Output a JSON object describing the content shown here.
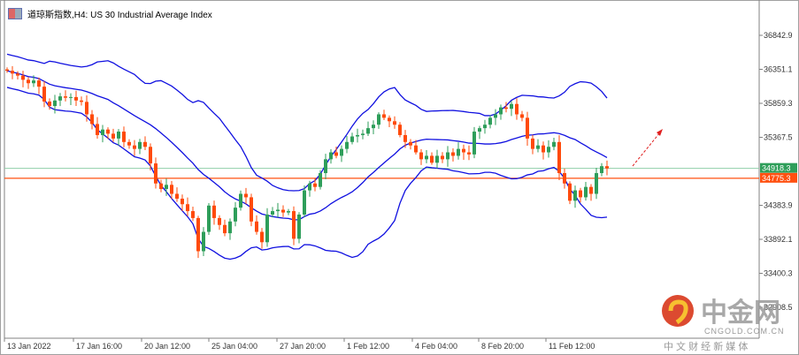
{
  "window": {
    "title": "道琼斯指数,H4:  US 30 Industrial Average Index"
  },
  "watermark": {
    "brand": "中金网",
    "url": "CNGOLD.COM.CN",
    "slogan": "中 文 财 经 新 媒 体"
  },
  "colors": {
    "bull": "#2e9e5a",
    "bear": "#ff4a0a",
    "band": "#1010e0",
    "bid_line": "#8fcfa8",
    "ask_line": "#ff5010",
    "arrow": "#e02020"
  },
  "chart_data": {
    "type": "candlestick",
    "symbol": "US 30 Industrial Average Index",
    "timeframe": "H4",
    "indicator": "Bollinger Bands (20, 2)",
    "ylim": [
      32700,
      37250
    ],
    "y_ticks": [
      "36842.9",
      "36351.1",
      "35859.3",
      "35367.5",
      "34383.9",
      "33892.1",
      "33400.3",
      "32908.5"
    ],
    "x_ticks": [
      "13 Jan 2022",
      "17 Jan 16:00",
      "20 Jan 12:00",
      "25 Jan 04:00",
      "27 Jan 20:00",
      "1 Feb 12:00",
      "4 Feb 04:00",
      "8 Feb 20:00",
      "11 Feb 12:00"
    ],
    "current_price_label": "34918.3",
    "level_label": "34775.3",
    "current_price": 34918.3,
    "level": 34775.3,
    "first_open": 36350,
    "closes": [
      36330,
      36290,
      36260,
      36200,
      36150,
      36190,
      36100,
      35885,
      35820,
      35900,
      35960,
      35940,
      35950,
      35900,
      35880,
      35700,
      35560,
      35400,
      35480,
      35420,
      35350,
      35450,
      35300,
      35250,
      35200,
      35300,
      35230,
      34990,
      34700,
      34620,
      34680,
      34550,
      34480,
      34400,
      34300,
      34200,
      33720,
      34000,
      34380,
      34200,
      34100,
      33980,
      34150,
      34350,
      34550,
      34500,
      34150,
      34000,
      33850,
      34250,
      34300,
      34320,
      34280,
      34300,
      33900,
      34250,
      34600,
      34700,
      34650,
      34850,
      35050,
      35150,
      35100,
      35200,
      35300,
      35380,
      35400,
      35420,
      35500,
      35550,
      35700,
      35650,
      35600,
      35550,
      35400,
      35300,
      35250,
      35150,
      35050,
      35100,
      35000,
      35100,
      35050,
      35150,
      35100,
      35200,
      35150,
      35120,
      35450,
      35500,
      35550,
      35650,
      35700,
      35800,
      35780,
      35850,
      35700,
      35650,
      35350,
      35200,
      35250,
      35150,
      35230,
      35300,
      34850,
      34700,
      34450,
      34600,
      34500,
      34650,
      34550,
      34850,
      34950,
      34918
    ]
  }
}
